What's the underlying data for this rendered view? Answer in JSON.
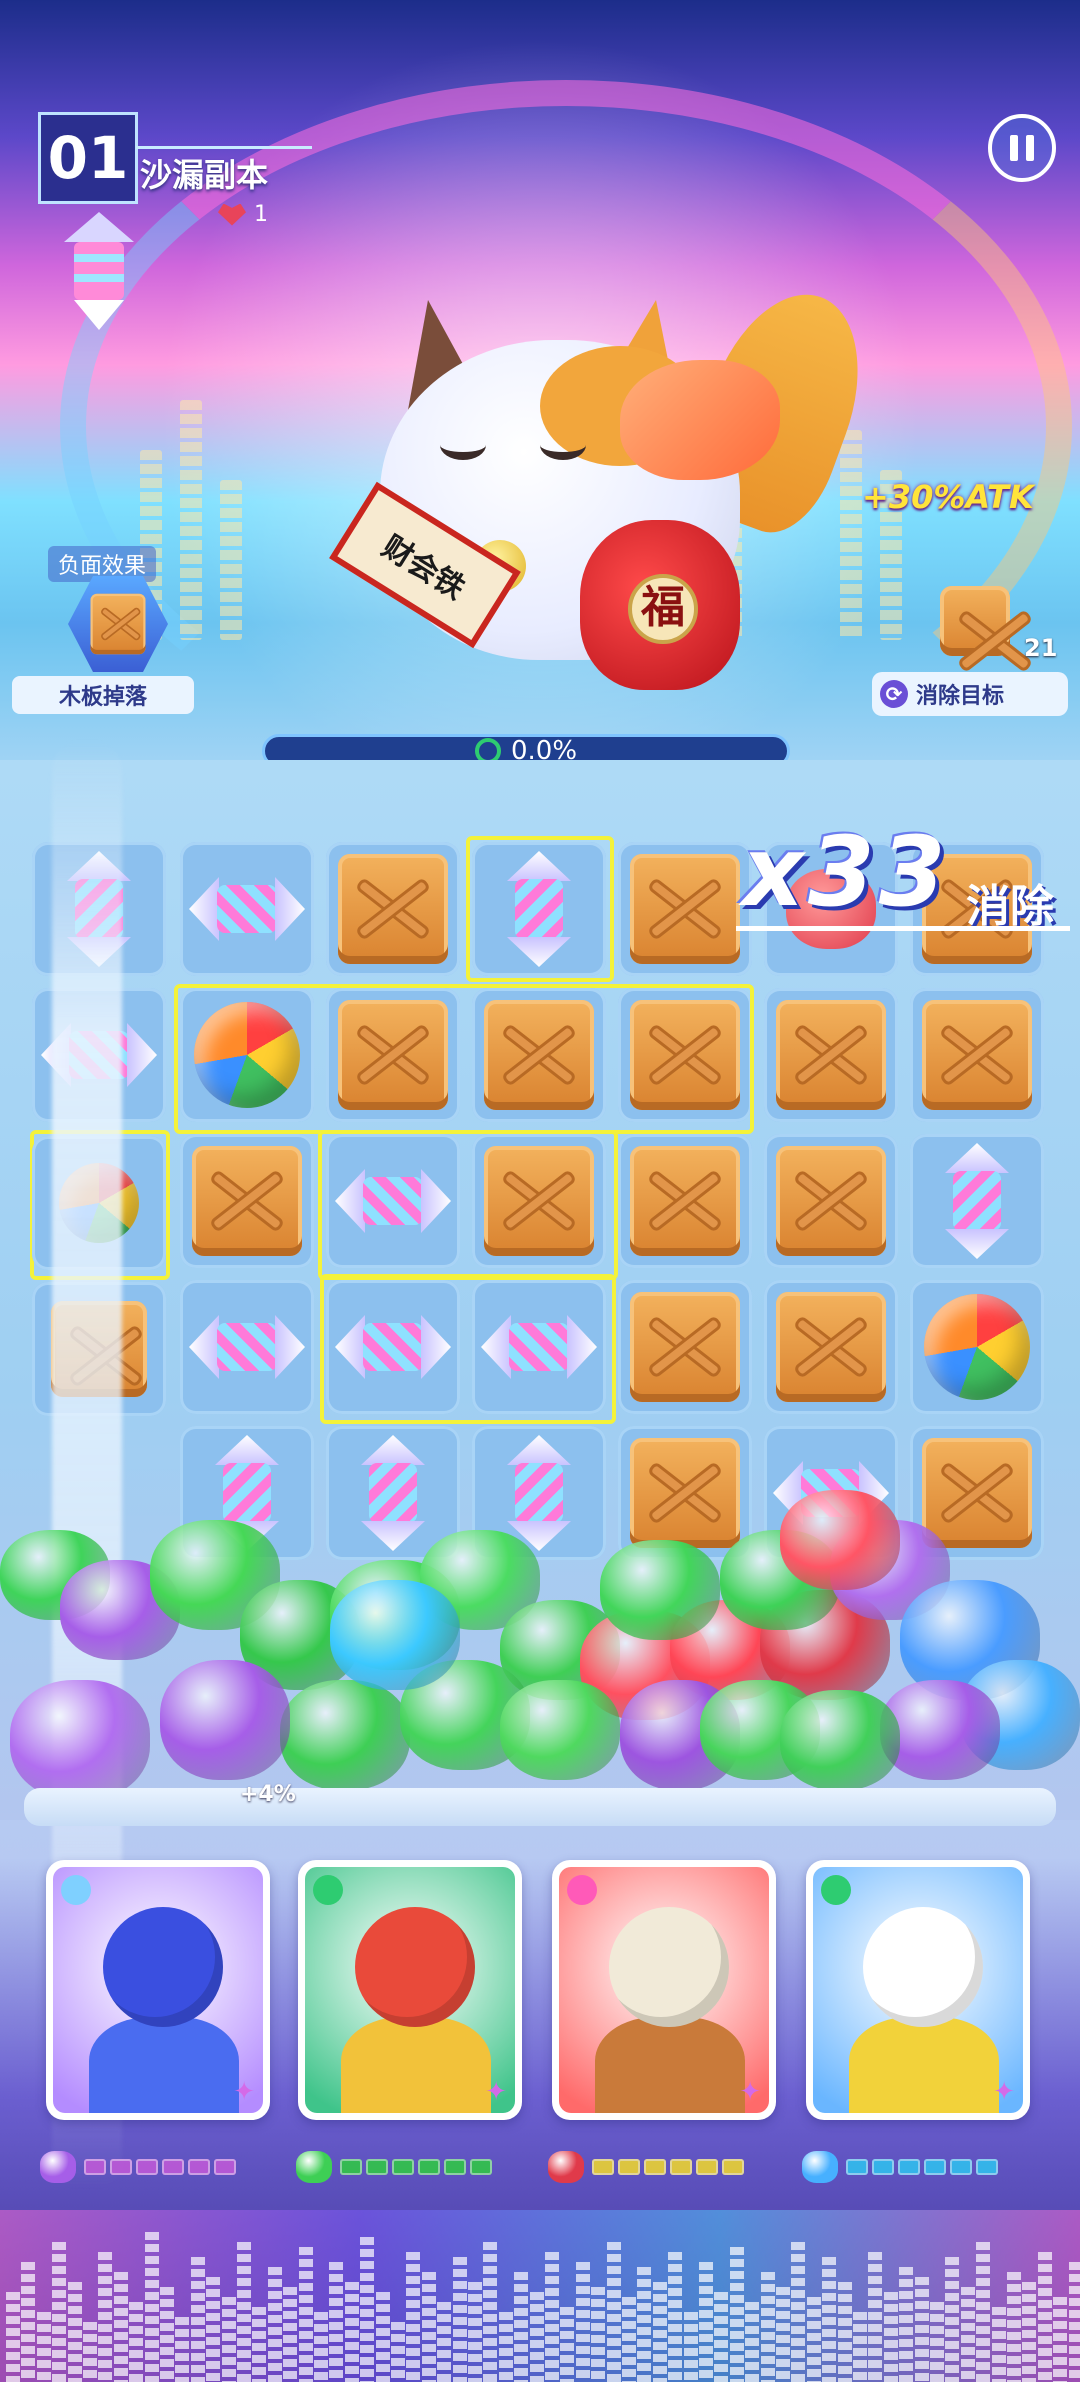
{
  "level": {
    "number": "01",
    "name": "沙漏副本",
    "hearts": "1"
  },
  "negative_effect": {
    "label": "负面效果",
    "name": "木板掉落"
  },
  "boss": {
    "scroll_text": "财会铁",
    "bag_text": "福",
    "attack_bonus": "+30%ATK"
  },
  "target": {
    "count": "21",
    "label": "消除目标"
  },
  "progress": {
    "value_text": "0.0%",
    "fraction": 0.0
  },
  "combo": {
    "multiplier": "x33",
    "label": "消除"
  },
  "board": {
    "rows": [
      [
        "rocket-h",
        "crate",
        "rocket-v",
        "crate",
        "monster",
        "crate"
      ],
      [
        "ball",
        "crate",
        "crate",
        "crate",
        "crate",
        "crate"
      ],
      [
        "crate",
        "rocket-h",
        "crate",
        "crate",
        "crate",
        "rocket-v"
      ],
      [
        "rocket-h",
        "rocket-h",
        "rocket-h",
        "crate",
        "crate",
        "ball"
      ],
      [
        "rocket-v",
        "rocket-v",
        "rocket-v",
        "crate",
        "rocket-h",
        "crate"
      ]
    ]
  },
  "pile_bonus": "+4%",
  "heroes": [
    {
      "name": "lightning-hero",
      "badge_icon": "snowflake-icon",
      "accent": "#b48cff",
      "energy_color": "#c35ad8",
      "energy_level": 0.0
    },
    {
      "name": "opera-hero",
      "badge_icon": "swirl-icon",
      "accent": "#3fc48a",
      "energy_color": "#2ecc40",
      "energy_level": 0.0
    },
    {
      "name": "caveman-hero",
      "badge_icon": "bolt-icon",
      "accent": "#ff6a6a",
      "energy_color": "#f2d92a",
      "energy_level": 0.0
    },
    {
      "name": "astronaut-hero",
      "badge_icon": "swirl-icon",
      "accent": "#6ab6ff",
      "energy_color": "#2ec4f0",
      "energy_level": 0.0
    }
  ],
  "colors": {
    "crate": "#e8923a",
    "highlight": "#f4f23a",
    "panel": "#eaf4ff"
  }
}
